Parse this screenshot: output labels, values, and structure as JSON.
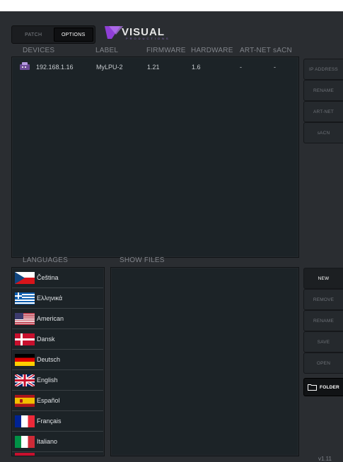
{
  "tabs": {
    "patch": "PATCH",
    "options": "OPTIONS"
  },
  "logo": {
    "name": "VISUAL",
    "sub": "PRODUCTIONS"
  },
  "devices": {
    "headers": {
      "devices": "DEVICES",
      "label": "LABEL",
      "firmware": "FIRMWARE",
      "hardware": "HARDWARE",
      "artnet": "ART-NET",
      "sacn": "sACN"
    },
    "rows": [
      {
        "ip": "192.168.1.16",
        "label": "MyLPU-2",
        "firmware": "1.21",
        "hardware": "1.6",
        "artnet": "-",
        "sacn": "-"
      }
    ]
  },
  "device_actions": [
    "IP ADDRESS",
    "RENAME",
    "ART-NET",
    "sACN"
  ],
  "languages": {
    "title": "LANGUAGES",
    "items": [
      "Čeština",
      "Ελληνικά",
      "American",
      "Dansk",
      "Deutsch",
      "English",
      "Español",
      "Français",
      "Italiano"
    ]
  },
  "showfiles": {
    "title": "SHOW FILES"
  },
  "file_actions": {
    "new": "NEW",
    "remove": "REMOVE",
    "rename": "RENAME",
    "save": "SAVE",
    "open": "OPEN",
    "folder": "FOLDER"
  },
  "version": "v1.11",
  "colors": {
    "accent_purple": "#8f3fd6",
    "panel": "#1c2327",
    "background": "#2a2d31"
  }
}
